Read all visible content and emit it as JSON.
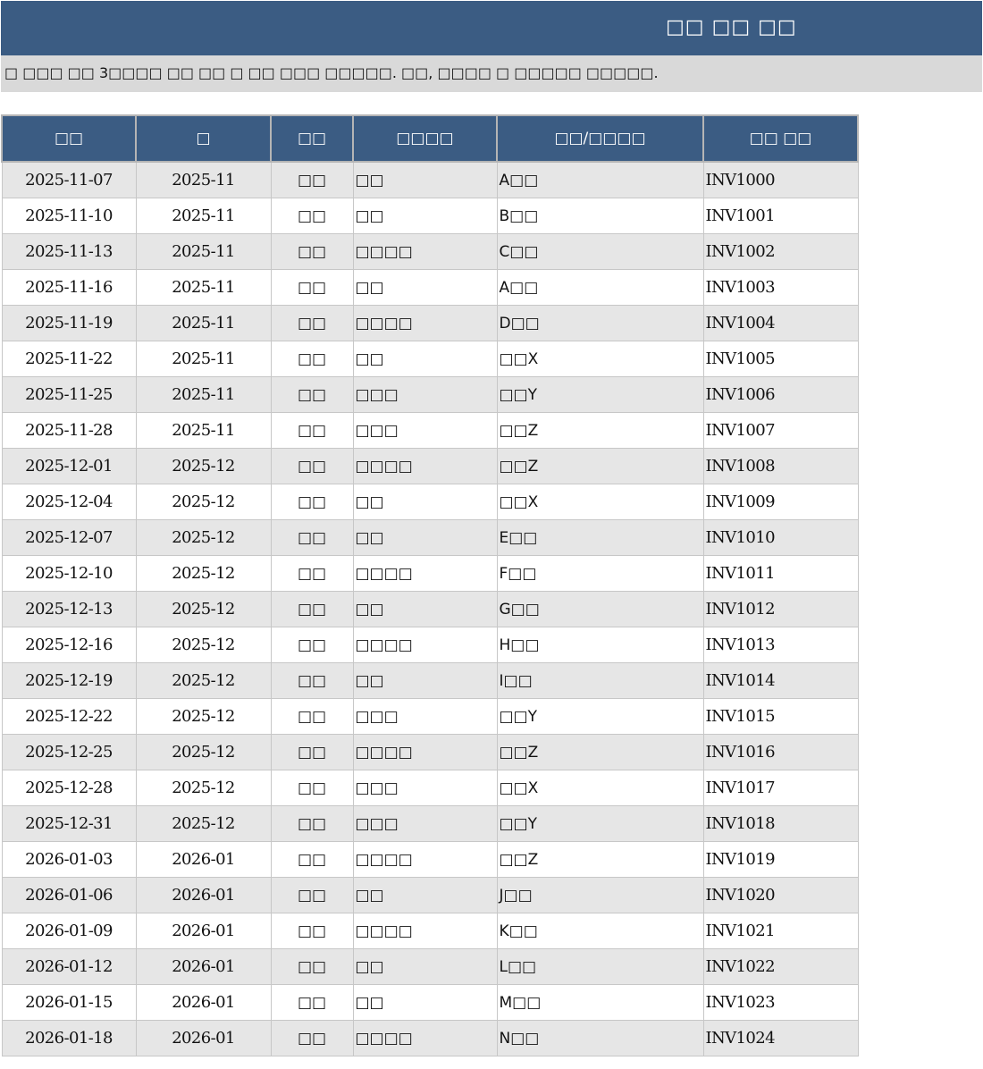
{
  "title": "□□ □□ □□",
  "description": "□ □□□ □□ 3□□□□ □□ □□ □ □□ □□□ □□□□□. □□, □□□□ □ □□□□□ □□□□□.",
  "table": {
    "headers": [
      "□□",
      "□",
      "□□",
      "□□□□",
      "□□/□□□□",
      "□□ □□"
    ],
    "rows": [
      [
        "2025-11-07",
        "2025-11",
        "□□",
        "□□",
        "A□□",
        "INV1000"
      ],
      [
        "2025-11-10",
        "2025-11",
        "□□",
        "□□",
        "B□□",
        "INV1001"
      ],
      [
        "2025-11-13",
        "2025-11",
        "□□",
        "□□□□",
        "C□□",
        "INV1002"
      ],
      [
        "2025-11-16",
        "2025-11",
        "□□",
        "□□",
        "A□□",
        "INV1003"
      ],
      [
        "2025-11-19",
        "2025-11",
        "□□",
        "□□□□",
        "D□□",
        "INV1004"
      ],
      [
        "2025-11-22",
        "2025-11",
        "□□",
        "□□",
        "□□X",
        "INV1005"
      ],
      [
        "2025-11-25",
        "2025-11",
        "□□",
        "□□□",
        "□□Y",
        "INV1006"
      ],
      [
        "2025-11-28",
        "2025-11",
        "□□",
        "□□□",
        "□□Z",
        "INV1007"
      ],
      [
        "2025-12-01",
        "2025-12",
        "□□",
        "□□□□",
        "□□Z",
        "INV1008"
      ],
      [
        "2025-12-04",
        "2025-12",
        "□□",
        "□□",
        "□□X",
        "INV1009"
      ],
      [
        "2025-12-07",
        "2025-12",
        "□□",
        "□□",
        "E□□",
        "INV1010"
      ],
      [
        "2025-12-10",
        "2025-12",
        "□□",
        "□□□□",
        "F□□",
        "INV1011"
      ],
      [
        "2025-12-13",
        "2025-12",
        "□□",
        "□□",
        "G□□",
        "INV1012"
      ],
      [
        "2025-12-16",
        "2025-12",
        "□□",
        "□□□□",
        "H□□",
        "INV1013"
      ],
      [
        "2025-12-19",
        "2025-12",
        "□□",
        "□□",
        "I□□",
        "INV1014"
      ],
      [
        "2025-12-22",
        "2025-12",
        "□□",
        "□□□",
        "□□Y",
        "INV1015"
      ],
      [
        "2025-12-25",
        "2025-12",
        "□□",
        "□□□□",
        "□□Z",
        "INV1016"
      ],
      [
        "2025-12-28",
        "2025-12",
        "□□",
        "□□□",
        "□□X",
        "INV1017"
      ],
      [
        "2025-12-31",
        "2025-12",
        "□□",
        "□□□",
        "□□Y",
        "INV1018"
      ],
      [
        "2026-01-03",
        "2026-01",
        "□□",
        "□□□□",
        "□□Z",
        "INV1019"
      ],
      [
        "2026-01-06",
        "2026-01",
        "□□",
        "□□",
        "J□□",
        "INV1020"
      ],
      [
        "2026-01-09",
        "2026-01",
        "□□",
        "□□□□",
        "K□□",
        "INV1021"
      ],
      [
        "2026-01-12",
        "2026-01",
        "□□",
        "□□",
        "L□□",
        "INV1022"
      ],
      [
        "2026-01-15",
        "2026-01",
        "□□",
        "□□",
        "M□□",
        "INV1023"
      ],
      [
        "2026-01-18",
        "2026-01",
        "□□",
        "□□□□",
        "N□□",
        "INV1024"
      ]
    ]
  },
  "colors": {
    "header_bg": "#3b5c83",
    "header_text": "#ffffff",
    "description_bg": "#d9d9d9",
    "row_alt_bg": "#e6e6e6",
    "row_bg": "#ffffff"
  }
}
